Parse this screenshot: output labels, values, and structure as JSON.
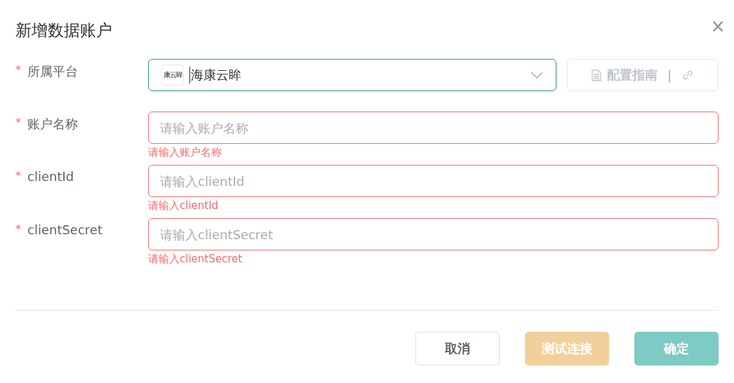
{
  "dialog": {
    "title": "新增数据账户",
    "close": "×"
  },
  "fields": [
    {
      "kind": "select",
      "label": "所属平台",
      "required_mark": "*",
      "logo_text": "康云眸",
      "value": "海康云眸",
      "guide": {
        "label": "配置指南",
        "separator": "|",
        "disabled": true
      }
    },
    {
      "kind": "input",
      "label": "账户名称",
      "required_mark": "*",
      "placeholder": "请输入账户名称",
      "error": "请输入账户名称"
    },
    {
      "kind": "input",
      "label": "clientId",
      "required_mark": "*",
      "placeholder": "请输入clientId",
      "error": "请输入clientId"
    },
    {
      "kind": "input",
      "label": "clientSecret",
      "required_mark": "*",
      "placeholder": "请输入clientSecret",
      "error": "请输入clientSecret"
    }
  ],
  "buttons": [
    {
      "kind": "plain",
      "label": "取消",
      "disabled": false
    },
    {
      "kind": "warning",
      "label": "测试连接",
      "disabled": true
    },
    {
      "kind": "primary",
      "label": "确定",
      "disabled": true
    }
  ]
}
